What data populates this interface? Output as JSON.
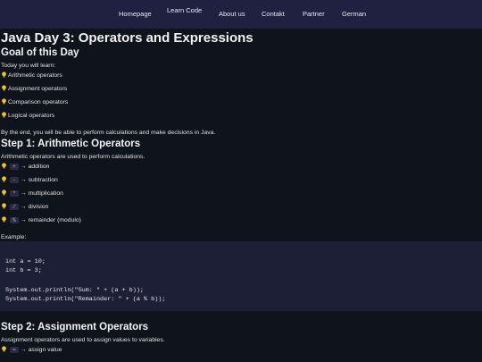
{
  "nav": {
    "items": [
      "Homepage",
      "Learn Code",
      "About us",
      "Contakt",
      "Partner",
      "German"
    ]
  },
  "page_title": "Java Day 3: Operators and Expressions",
  "goal": {
    "heading": "Goal of this Day",
    "intro": "Today you will learn:",
    "items": [
      "Arithmetic operators",
      "Assignment operators",
      "Comparison operators",
      "Logical operators"
    ],
    "outro": "By the end, you will be able to perform calculations and make decisions in Java."
  },
  "step1": {
    "heading": "Step 1: Arithmetic Operators",
    "intro": "Arithmetic operators are used to perform calculations.",
    "items": [
      {
        "op": "+",
        "desc": "→ addition"
      },
      {
        "op": "-",
        "desc": "→ subtraction"
      },
      {
        "op": "*",
        "desc": "→ multiplication"
      },
      {
        "op": "/",
        "desc": "→ division"
      },
      {
        "op": "%",
        "desc": "→ remainder (modulo)"
      }
    ],
    "example_label": "Example:",
    "code_lines": [
      "int a = 10;",
      "int b = 3;",
      "",
      "System.out.println(\"Sum: \" + (a + b));",
      "System.out.println(\"Remainder: \" + (a % b));"
    ]
  },
  "step2": {
    "heading": "Step 2: Assignment Operators",
    "intro": "Assignment operators are used to assign values to variables.",
    "items": [
      {
        "op": "=",
        "desc": "→ assign value"
      }
    ]
  },
  "colors": {
    "nav_bg": "#202040",
    "page_bg": "#0f131b",
    "code_bg": "#1d1f36",
    "bulb": "#f5c518"
  },
  "icons": {
    "bullet": "lightbulb-icon"
  }
}
